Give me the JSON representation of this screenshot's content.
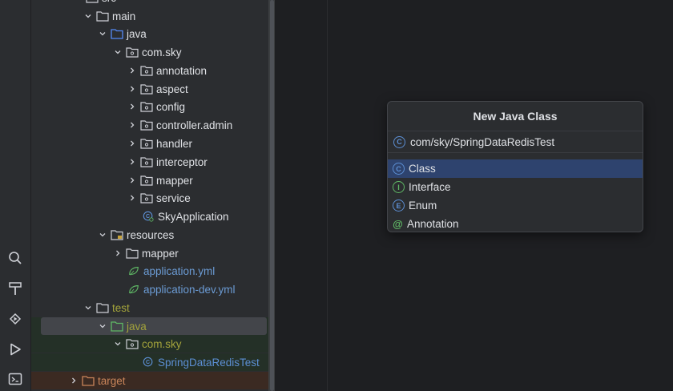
{
  "toolbar": {
    "icons": [
      "search-icon",
      "build-icon",
      "services-icon",
      "run-icon",
      "terminal-icon"
    ]
  },
  "tree": {
    "src": "src",
    "main": "main",
    "java": "java",
    "com_sky": "com.sky",
    "annotation": "annotation",
    "aspect": "aspect",
    "config": "config",
    "controller_admin": "controller.admin",
    "handler": "handler",
    "interceptor": "interceptor",
    "mapper": "mapper",
    "service": "service",
    "sky_application": "SkyApplication",
    "resources": "resources",
    "res_mapper": "mapper",
    "application_yml": "application.yml",
    "application_dev_yml": "application-dev.yml",
    "test": "test",
    "test_java": "java",
    "test_com_sky": "com.sky",
    "spring_data_redis_test": "SpringDataRedisTest",
    "target": "target"
  },
  "dialog": {
    "title": "New Java Class",
    "input_value": "com/sky/SpringDataRedisTest",
    "kinds": [
      {
        "label": "Class",
        "badge": "C",
        "selected": true
      },
      {
        "label": "Interface",
        "badge": "I",
        "selected": false
      },
      {
        "label": "Enum",
        "badge": "E",
        "selected": false
      },
      {
        "label": "Annotation",
        "badge": "@",
        "selected": false
      }
    ]
  },
  "colors": {
    "accent_selected": "#2e436e",
    "test_folder": "#a3a33b",
    "target_folder": "#c9855a",
    "resource_file": "#6b9bd4"
  }
}
